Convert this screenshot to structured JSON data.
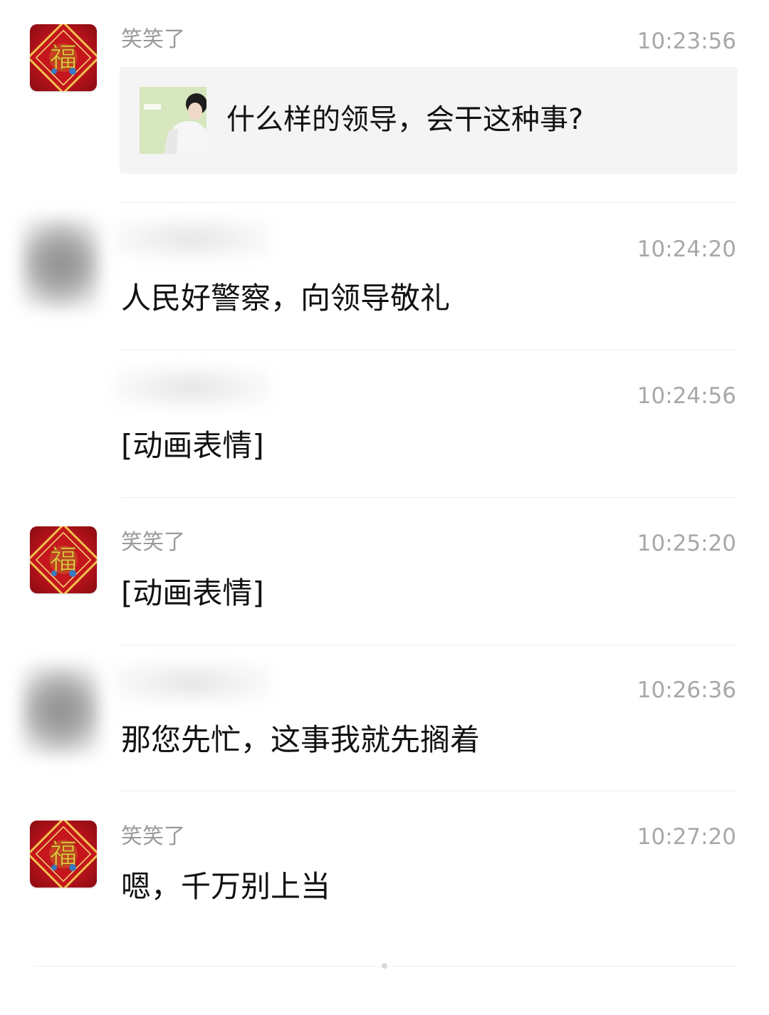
{
  "colors": {
    "background": "#ffffff",
    "sender_gray": "#9a9a9a",
    "time_gray": "#a8a8a8",
    "text": "#111111",
    "quote_bg": "#f4f4f4",
    "avatar_red": "#b1121a",
    "divider": "#ececec"
  },
  "messages": [
    {
      "sender": "笑笑了",
      "avatar": "fu-red-avatar",
      "time": "10:23:56",
      "quote": {
        "thumbnail": "person-meme-thumbnail",
        "title": "什么样的领导，会干这种事?"
      }
    },
    {
      "sender": "",
      "avatar": "blurred-avatar",
      "time": "10:24:20",
      "text": "人民好警察，向领导敬礼"
    },
    {
      "sender": "",
      "avatar": "none",
      "time": "10:24:56",
      "text": "[动画表情]"
    },
    {
      "sender": "笑笑了",
      "avatar": "fu-red-avatar",
      "time": "10:25:20",
      "text": "[动画表情]"
    },
    {
      "sender": "",
      "avatar": "blurred-avatar",
      "time": "10:26:36",
      "text": "那您先忙，这事我就先搁着"
    },
    {
      "sender": "笑笑了",
      "avatar": "fu-red-avatar",
      "time": "10:27:20",
      "text": "嗯，千万别上当"
    }
  ]
}
